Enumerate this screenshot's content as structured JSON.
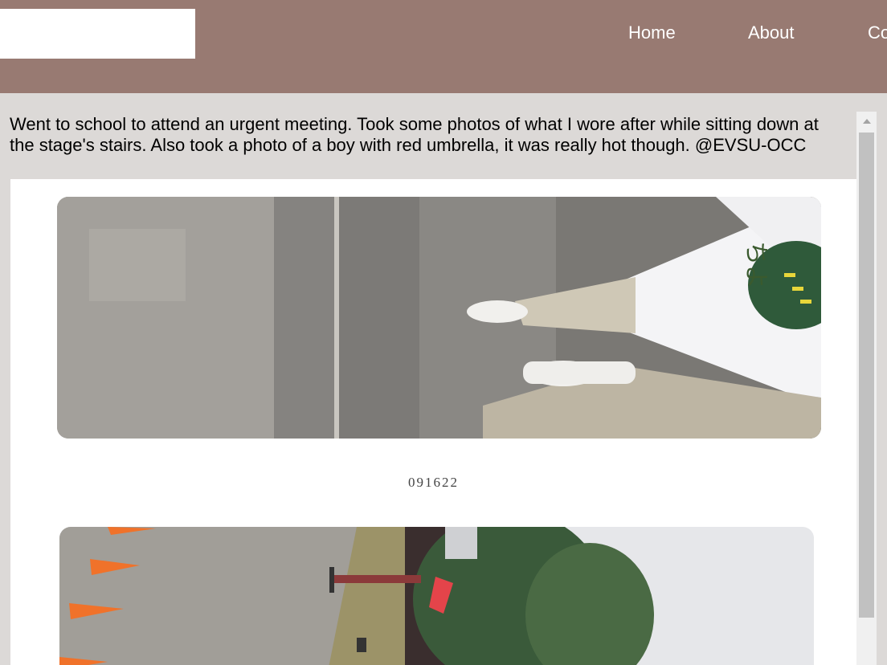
{
  "nav": {
    "items": [
      {
        "label": "Home"
      },
      {
        "label": "About"
      },
      {
        "label": "Co"
      }
    ]
  },
  "post": {
    "caption": "Went to school to attend an urgent meeting. Took some photos of what I wore after while sitting down at the stage's stairs. Also took a photo of a boy with red umbrella, it was really hot though. @EVSU-OCC",
    "photo_date": "091622"
  },
  "colors": {
    "header": "#987a72",
    "page_background": "#dcd9d7",
    "panel": "#ffffff"
  }
}
